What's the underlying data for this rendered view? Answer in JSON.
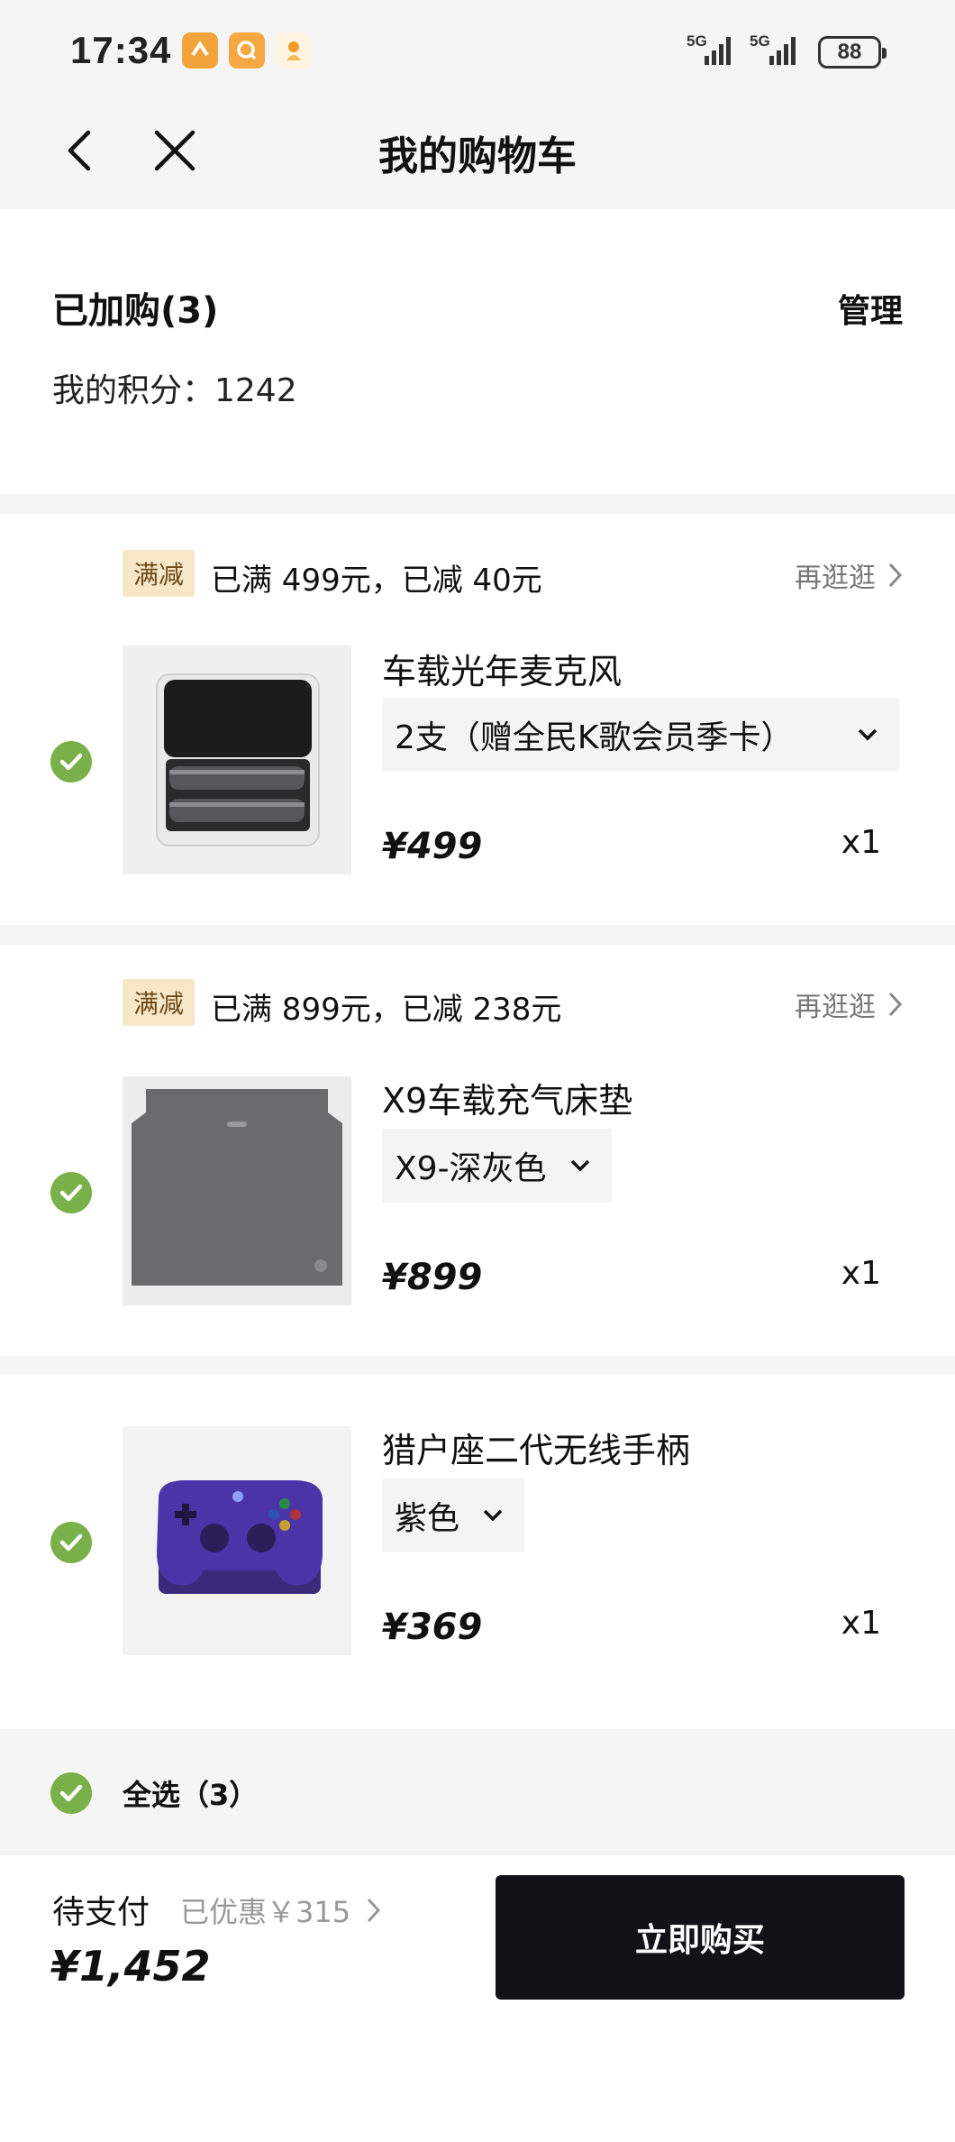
{
  "status_bar": {
    "time": "17:34",
    "signal_1": "5G",
    "signal_2": "5G",
    "battery": "88"
  },
  "nav": {
    "title": "我的购物车",
    "back_icon": "chevron-left-icon",
    "close_icon": "close-icon"
  },
  "header": {
    "added_label": "已加购(3)",
    "manage_label": "管理",
    "points_label": "我的积分：1242"
  },
  "groups": [
    {
      "promo_tag": "满减",
      "promo_text": "已满 499元，已减 40元",
      "browse_label": "再逛逛",
      "product": {
        "name": "车载光年麦克风",
        "variant": "2支（赠全民K歌会员季卡）",
        "price": "¥499",
        "quantity": "x1",
        "selected": true
      }
    },
    {
      "promo_tag": "满减",
      "promo_text": "已满 899元，已减 238元",
      "browse_label": "再逛逛",
      "product": {
        "name": "X9车载充气床垫",
        "variant": "X9-深灰色",
        "price": "¥899",
        "quantity": "x1",
        "selected": true
      }
    },
    {
      "product": {
        "name": "猎户座二代无线手柄",
        "variant": "紫色",
        "price": "¥369",
        "quantity": "x1",
        "selected": true
      }
    }
  ],
  "footer": {
    "select_all_label": "全选（3）",
    "pending_label": "待支付",
    "discount_label": "已优惠￥315",
    "total": "¥1,452",
    "buy_label": "立即购买"
  },
  "colors": {
    "check_green": "#7ab04a",
    "promo_bg": "#f6e7c8",
    "buy_bg": "#111318"
  }
}
